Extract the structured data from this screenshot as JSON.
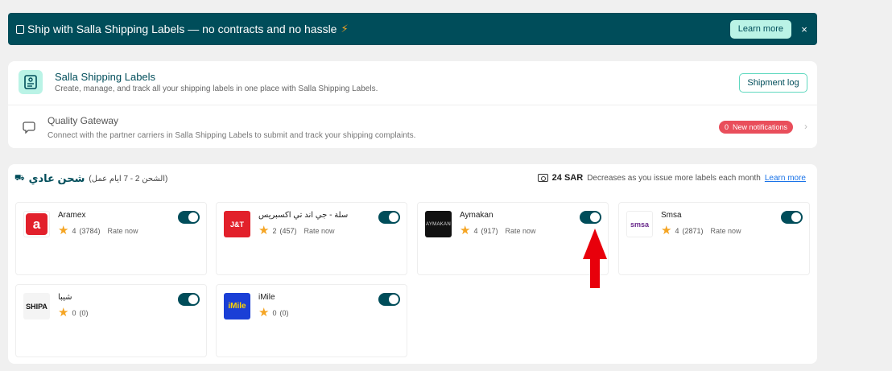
{
  "banner": {
    "message": "Ship with Salla Shipping Labels — no contracts and no hassle",
    "learn_more": "Learn more",
    "close": "×"
  },
  "labels": {
    "title": "Salla Shipping Labels",
    "subtitle": "Create, manage, and track all your shipping labels in one place with Salla Shipping Labels.",
    "shipment_log": "Shipment log"
  },
  "gateway": {
    "title": "Quality Gateway",
    "subtitle": "Connect with the partner carriers in Salla Shipping Labels to submit and track your shipping complaints.",
    "notif_count": "0",
    "notif_label": "New notifications"
  },
  "standard": {
    "title": "شحن عادي",
    "duration": "(الشحن 2 - 7 ايام عمل)",
    "price": "24 SAR",
    "price_note": "Decreases as you issue more labels each month",
    "learn_more": "Learn more"
  },
  "carriers": [
    {
      "name": "Aramex",
      "rating": "4",
      "count": "(3784)",
      "rate_label": "Rate now",
      "logo_text": "a",
      "enabled": true
    },
    {
      "name": "سلة - جي اند تي اكسبريس",
      "rating": "2",
      "count": "(457)",
      "rate_label": "Rate now",
      "logo_text": "J&T",
      "enabled": true
    },
    {
      "name": "Aymakan",
      "rating": "4",
      "count": "(917)",
      "rate_label": "Rate now",
      "logo_text": "AYMAKAN",
      "enabled": true
    },
    {
      "name": "Smsa",
      "rating": "4",
      "count": "(2871)",
      "rate_label": "Rate now",
      "logo_text": "smsa",
      "enabled": true
    },
    {
      "name": "شيبا",
      "rating": "0",
      "count": "(0)",
      "rate_label": "",
      "logo_text": "SHIPA",
      "enabled": true
    },
    {
      "name": "iMile",
      "rating": "0",
      "count": "(0)",
      "rate_label": "",
      "logo_text": "iMile",
      "enabled": true
    }
  ],
  "colors": {
    "primary": "#004d5a",
    "accent": "#baf3e6",
    "notification": "#e94e5b",
    "star": "#f5a524",
    "arrow": "#e8000b"
  }
}
